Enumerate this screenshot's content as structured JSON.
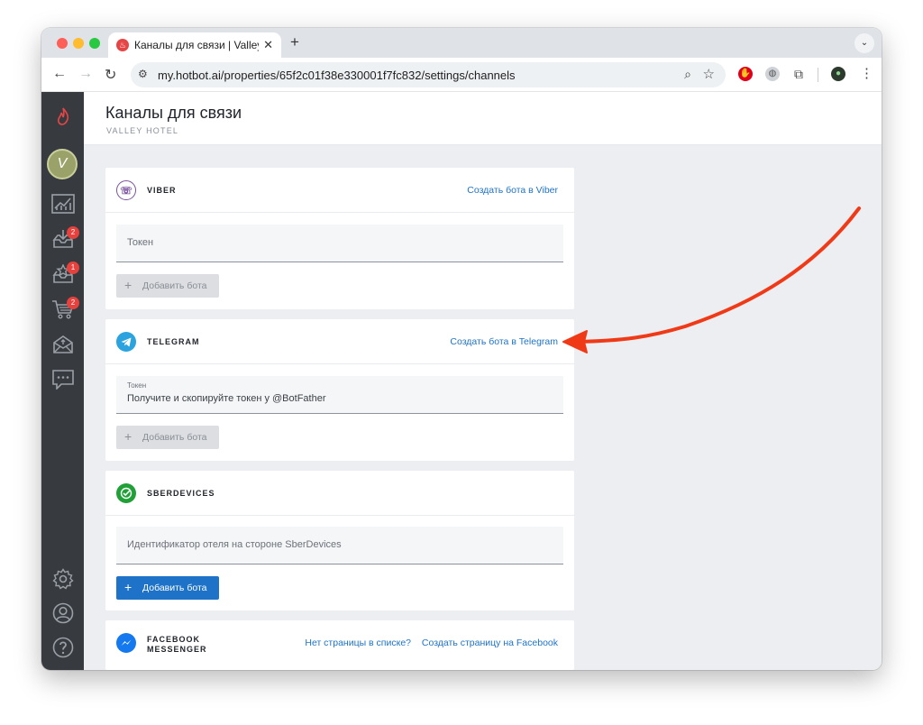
{
  "browser": {
    "tab_title": "Каналы для связи | Valley Ho",
    "tab_close": "✕",
    "tab_new": "+",
    "tab_menu": "⌄",
    "url": "my.hotbot.ai/properties/65f2c01f38e330001f7fc832/settings/channels"
  },
  "sidebar": {
    "badges": [
      "2",
      "1",
      "2"
    ]
  },
  "header": {
    "title": "Каналы для связи",
    "subtitle": "VALLEY HOTEL"
  },
  "channels": {
    "viber": {
      "name": "VIBER",
      "link": "Создать бота в Viber",
      "token_placeholder": "Токен",
      "add_label": "Добавить бота"
    },
    "telegram": {
      "name": "TELEGRAM",
      "link": "Создать бота в Telegram",
      "token_label": "Токен",
      "token_value": "Получите и скопируйте токен у @BotFather",
      "add_label": "Добавить бота"
    },
    "sber": {
      "name": "SBERDEVICES",
      "id_placeholder": "Идентификатор отеля на стороне SberDevices",
      "add_label": "Добавить бота"
    },
    "facebook": {
      "name_line1": "FACEBOOK",
      "name_line2": "MESSENGER",
      "link_missing": "Нет страницы в списке?",
      "link_create": "Создать страницу на Facebook"
    }
  },
  "colors": {
    "accent": "#1e73c8",
    "sidebar": "#373b40",
    "annotation": "#f03a17"
  }
}
